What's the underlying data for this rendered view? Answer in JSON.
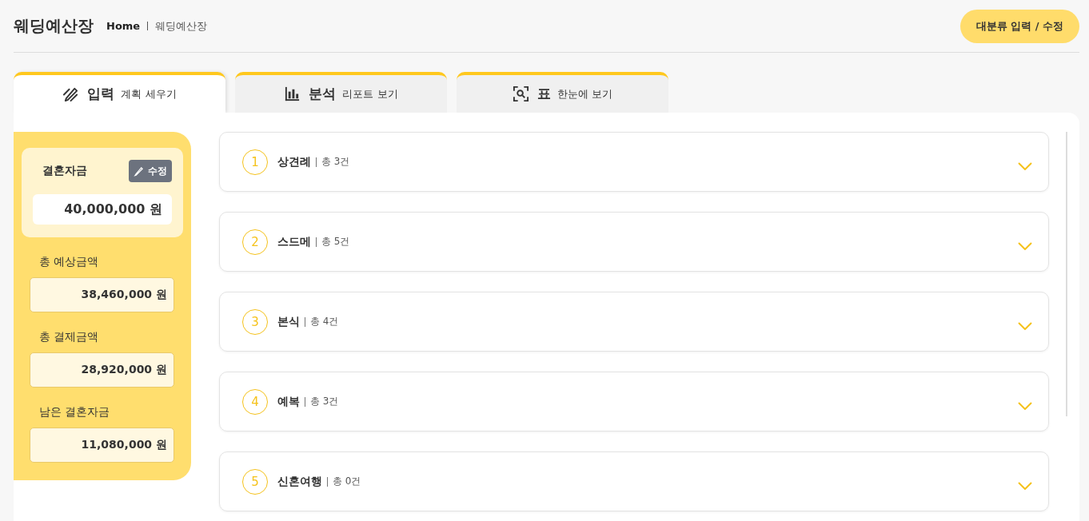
{
  "header": {
    "title": "웨딩예산장",
    "breadcrumb": [
      "Home",
      "웨딩예산장"
    ],
    "action_button": "대분류 입력 / 수정"
  },
  "tabs": [
    {
      "label": "입력",
      "sublabel": "계획 세우기",
      "kind": "input",
      "selected": true
    },
    {
      "label": "분석",
      "sublabel": "리포트 보기",
      "kind": "analysis",
      "selected": false
    },
    {
      "label": "표",
      "sublabel": "한눈에 보기",
      "kind": "table",
      "selected": false
    }
  ],
  "fund": {
    "label": "결혼자금",
    "edit_button": "수정",
    "value": "40,000,000 원"
  },
  "summary": [
    {
      "label": "총 예상금액",
      "value": "38,460,000 원"
    },
    {
      "label": "총 결제금액",
      "value": "28,920,000 원"
    },
    {
      "label": "남은 결혼자금",
      "value": "11,080,000 원"
    }
  ],
  "categories": [
    {
      "number": "1",
      "name": "상견례",
      "count": "총 3건",
      "expanded": false
    },
    {
      "number": "2",
      "name": "스드메",
      "count": "총 5건",
      "expanded": false
    },
    {
      "number": "3",
      "name": "본식",
      "count": "총 4건",
      "expanded": false
    },
    {
      "number": "4",
      "name": "예복",
      "count": "총 3건",
      "expanded": false
    },
    {
      "number": "5",
      "name": "신혼여행",
      "count": "총 0건",
      "expanded": false
    }
  ]
}
